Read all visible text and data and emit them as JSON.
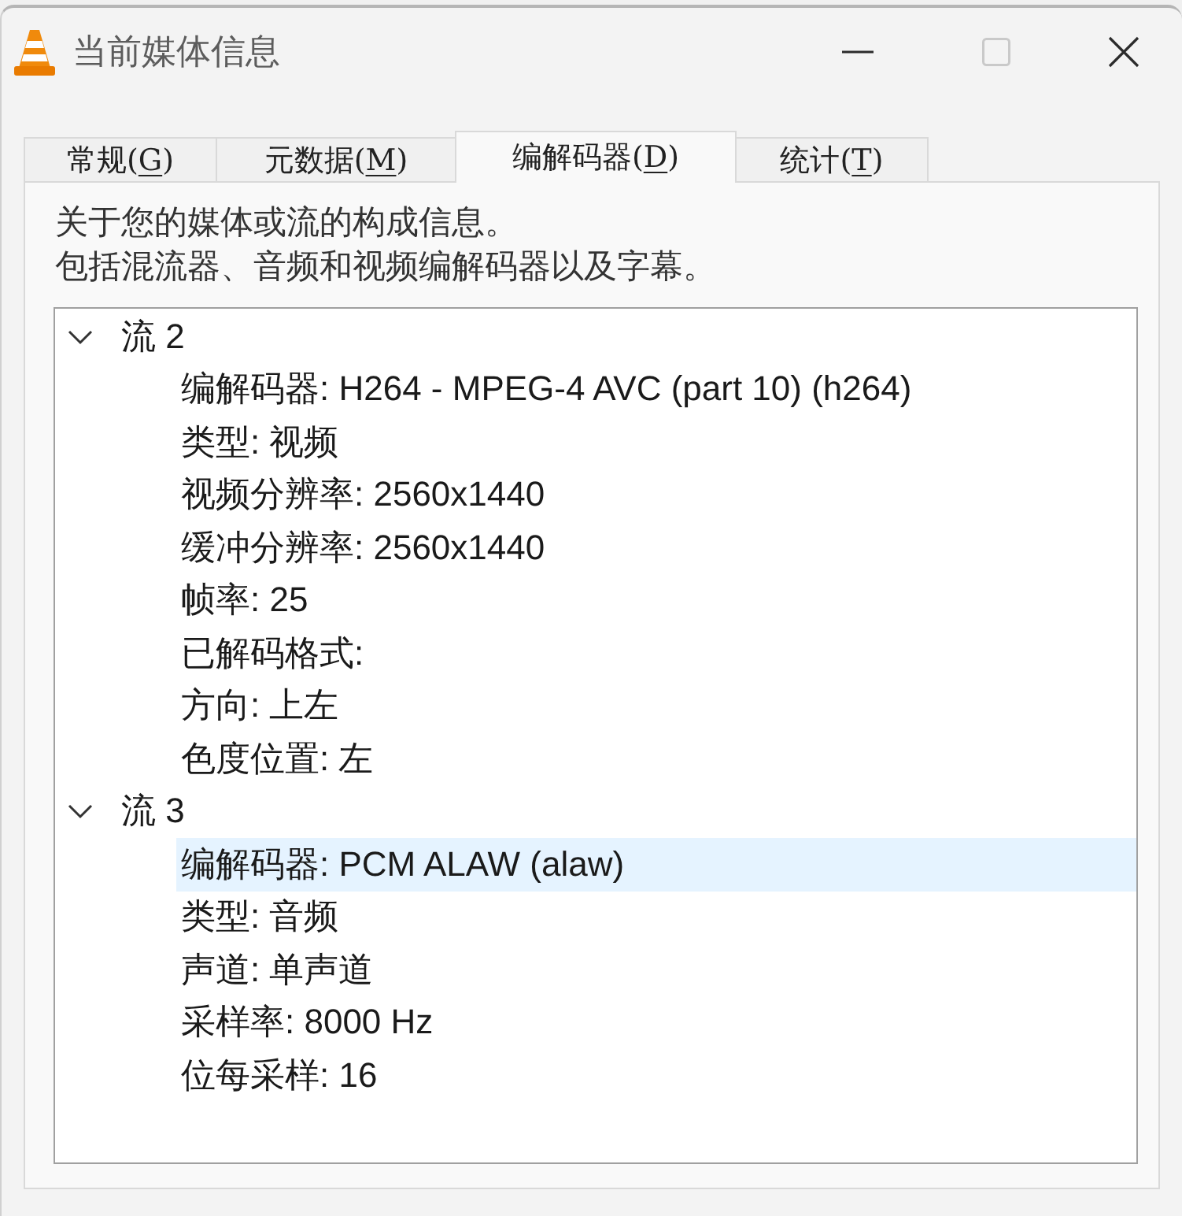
{
  "window": {
    "title": "当前媒体信息",
    "controls": [
      {
        "kind": "minimize",
        "disabled": false
      },
      {
        "kind": "maximize",
        "disabled": true
      },
      {
        "kind": "close",
        "disabled": false
      }
    ]
  },
  "tabs": [
    {
      "label": "常规(",
      "access_key": "G",
      "label_end": ")",
      "selected": false
    },
    {
      "label": "元数据(",
      "access_key": "M",
      "label_end": ")",
      "selected": false
    },
    {
      "label": "编解码器(",
      "access_key": "D",
      "label_end": ")",
      "selected": true
    },
    {
      "label": "统计(",
      "access_key": "T",
      "label_end": ")",
      "selected": false
    }
  ],
  "description": [
    "关于您的媒体或流的构成信息。",
    "包括混流器、音频和视频编解码器以及字幕。"
  ],
  "tree": {
    "nodes": [
      {
        "label": "流 2",
        "expanded": true,
        "selected": false,
        "children": [
          {
            "label": "编解码器: H264 - MPEG-4 AVC (part 10) (h264)",
            "selected": false
          },
          {
            "label": "类型: 视频",
            "selected": false
          },
          {
            "label": "视频分辨率: 2560x1440",
            "selected": false
          },
          {
            "label": "缓冲分辨率: 2560x1440",
            "selected": false
          },
          {
            "label": "帧率: 25",
            "selected": false
          },
          {
            "label": "已解码格式:",
            "selected": false
          },
          {
            "label": "方向: 上左",
            "selected": false
          },
          {
            "label": "色度位置: 左",
            "selected": false
          }
        ]
      },
      {
        "label": "流 3",
        "expanded": true,
        "selected": false,
        "children": [
          {
            "label": "编解码器: PCM ALAW (alaw)",
            "selected": true
          },
          {
            "label": "类型: 音频",
            "selected": false
          },
          {
            "label": "声道: 单声道",
            "selected": false
          },
          {
            "label": "采样率: 8000 Hz",
            "selected": false
          },
          {
            "label": "位每采样: 16",
            "selected": false
          }
        ]
      }
    ]
  }
}
